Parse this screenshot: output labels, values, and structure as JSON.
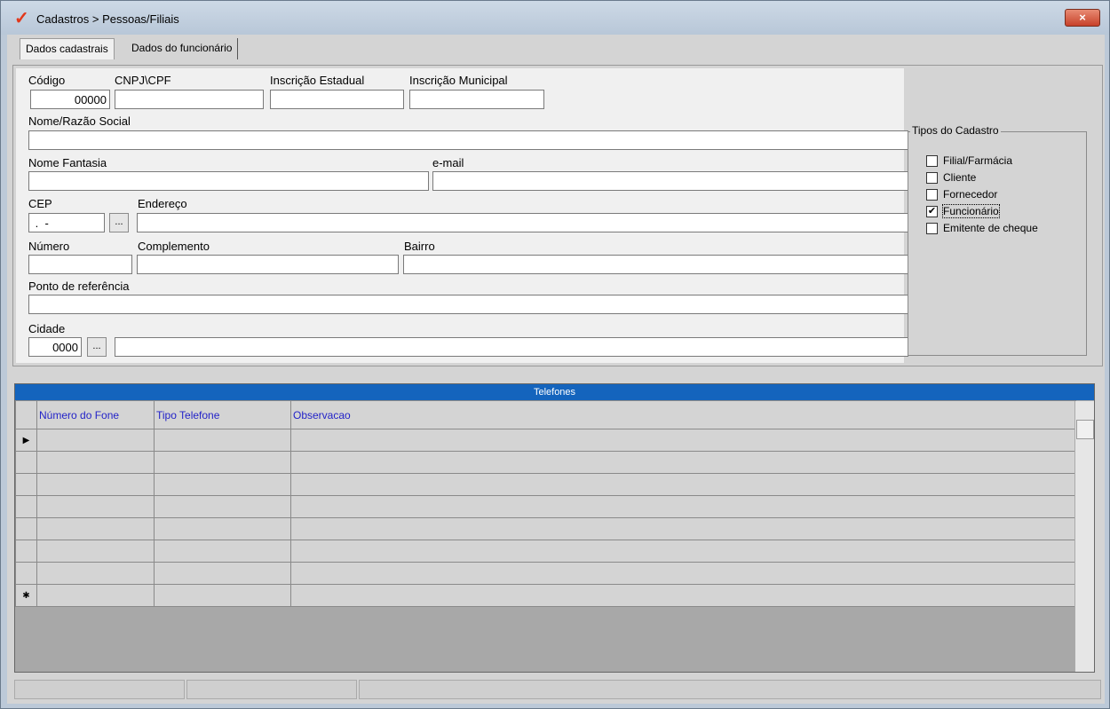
{
  "window": {
    "title": "Cadastros > Pessoas/Filiais",
    "close_label": "×"
  },
  "tabs": [
    {
      "label": "Dados cadastrais"
    },
    {
      "label": "Dados do funcionário"
    }
  ],
  "form": {
    "codigo": {
      "label": "Código",
      "value": "00000"
    },
    "cnpj": {
      "label": "CNPJ\\CPF",
      "value": ""
    },
    "ie": {
      "label": "Inscrição Estadual",
      "value": ""
    },
    "im": {
      "label": "Inscrição Municipal",
      "value": ""
    },
    "nome": {
      "label": "Nome/Razão Social",
      "value": ""
    },
    "fantasia": {
      "label": "Nome Fantasia",
      "value": ""
    },
    "email": {
      "label": "e-mail",
      "value": ""
    },
    "cep": {
      "label": "CEP",
      "value": " .  -"
    },
    "endereco": {
      "label": "Endereço",
      "value": ""
    },
    "numero": {
      "label": "Número",
      "value": ""
    },
    "complemento": {
      "label": "Complemento",
      "value": ""
    },
    "bairro": {
      "label": "Bairro",
      "value": ""
    },
    "referencia": {
      "label": "Ponto de referência",
      "value": ""
    },
    "cidade": {
      "label": "Cidade",
      "code": "0000",
      "name": ""
    },
    "lookup_label": "..."
  },
  "tipos": {
    "title": "Tipos do Cadastro",
    "items": [
      {
        "label": "Filial/Farmácia",
        "checked": false
      },
      {
        "label": "Cliente",
        "checked": false
      },
      {
        "label": "Fornecedor",
        "checked": false
      },
      {
        "label": "Funcionário",
        "checked": true
      },
      {
        "label": "Emitente de cheque",
        "checked": false
      }
    ]
  },
  "telefones": {
    "title": "Telefones",
    "columns": [
      "Número do Fone",
      "Tipo Telefone",
      "Observacao"
    ],
    "indicator_current": "▶",
    "indicator_new": "✱"
  }
}
